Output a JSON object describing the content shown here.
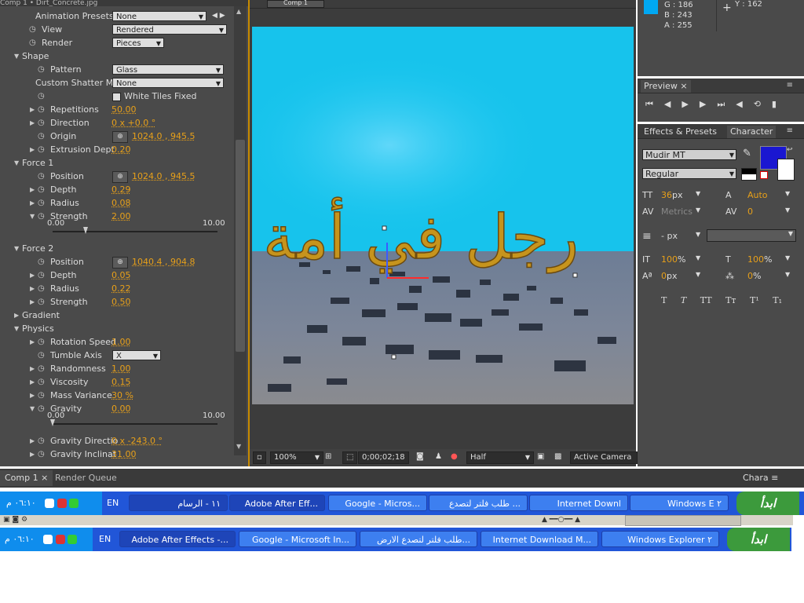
{
  "effects_panel": {
    "header": "Comp 1 • Dirt_Concrete.jpg",
    "rows": [
      {
        "type": "dd",
        "indent": 45,
        "label": "Animation Presets:",
        "value": "None",
        "width": 120
      },
      {
        "type": "dd",
        "indent": 45,
        "sw": true,
        "label": "View",
        "value": "Rendered",
        "width": 146
      },
      {
        "type": "dd",
        "indent": 45,
        "sw": true,
        "label": "Render",
        "value": "Pieces",
        "width": 66
      },
      {
        "type": "group",
        "indent": 16,
        "open": true,
        "label": "Shape"
      },
      {
        "type": "dd",
        "indent": 56,
        "sw": true,
        "label": "Pattern",
        "value": "Glass",
        "width": 142
      },
      {
        "type": "dd",
        "indent": 45,
        "label": "Custom Shatter Ma",
        "value": "None",
        "width": 142
      },
      {
        "type": "check",
        "indent": 56,
        "sw": true,
        "label": "",
        "value": "White Tiles Fixed"
      },
      {
        "type": "val",
        "indent": 56,
        "tri": true,
        "sw": true,
        "label": "Repetitions",
        "value": "50.00"
      },
      {
        "type": "val",
        "indent": 56,
        "tri": true,
        "sw": true,
        "label": "Direction",
        "value": "0 x +0.0 °"
      },
      {
        "type": "pt",
        "indent": 56,
        "sw": true,
        "label": "Origin",
        "value": "1024.0 , 945.5"
      },
      {
        "type": "val",
        "indent": 56,
        "tri": true,
        "sw": true,
        "label": "Extrusion Dept",
        "value": "0.20"
      },
      {
        "type": "group",
        "indent": 16,
        "open": true,
        "label": "Force 1"
      },
      {
        "type": "pt",
        "indent": 56,
        "sw": true,
        "label": "Position",
        "value": "1024.0 , 945.5"
      },
      {
        "type": "val",
        "indent": 56,
        "tri": true,
        "sw": true,
        "label": "Depth",
        "value": "0.29"
      },
      {
        "type": "val",
        "indent": 56,
        "tri": true,
        "sw": true,
        "label": "Radius",
        "value": "0.08"
      },
      {
        "type": "val",
        "indent": 56,
        "tri": true,
        "open": true,
        "sw": true,
        "label": "Strength",
        "value": "2.00"
      },
      {
        "type": "slider",
        "min": "0.00",
        "max": "10.00",
        "pos": 0.2
      },
      {
        "type": "group",
        "indent": 16,
        "open": true,
        "label": "Force 2"
      },
      {
        "type": "pt",
        "indent": 56,
        "sw": true,
        "label": "Position",
        "value": "1040.4 , 904.8"
      },
      {
        "type": "val",
        "indent": 56,
        "tri": true,
        "sw": true,
        "label": "Depth",
        "value": "0.05"
      },
      {
        "type": "val",
        "indent": 56,
        "tri": true,
        "sw": true,
        "label": "Radius",
        "value": "0.22"
      },
      {
        "type": "val",
        "indent": 56,
        "tri": true,
        "sw": true,
        "label": "Strength",
        "value": "0.50"
      },
      {
        "type": "group",
        "indent": 16,
        "open": false,
        "label": "Gradient"
      },
      {
        "type": "group",
        "indent": 16,
        "open": true,
        "label": "Physics"
      },
      {
        "type": "val",
        "indent": 56,
        "tri": true,
        "sw": true,
        "label": "Rotation Speed",
        "value": "1.00"
      },
      {
        "type": "dd",
        "indent": 56,
        "sw": true,
        "label": "Tumble Axis",
        "value": "X",
        "width": 62
      },
      {
        "type": "val",
        "indent": 56,
        "tri": true,
        "sw": true,
        "label": "Randomness",
        "value": "1.00"
      },
      {
        "type": "val",
        "indent": 56,
        "tri": true,
        "sw": true,
        "label": "Viscosity",
        "value": "0.15"
      },
      {
        "type": "val",
        "indent": 56,
        "tri": true,
        "sw": true,
        "label": "Mass Variance",
        "value": "30 %"
      },
      {
        "type": "val",
        "indent": 56,
        "tri": true,
        "open": true,
        "sw": true,
        "label": "Gravity",
        "value": "0.00"
      },
      {
        "type": "slider",
        "min": "0.00",
        "max": "10.00",
        "pos": 0.0
      },
      {
        "type": "val",
        "indent": 56,
        "tri": true,
        "sw": true,
        "label": "Gravity Directio",
        "value": "0 x -243.0 °"
      },
      {
        "type": "val",
        "indent": 56,
        "tri": true,
        "sw": true,
        "label": "Gravity Inclinat",
        "value": "31.00"
      }
    ]
  },
  "viewer": {
    "tab": "Comp 1",
    "arabic_text": "رجل في أمة",
    "zoom": "100%",
    "timecode": "0;00;02;18",
    "resolution": "Half",
    "camera": "Active Camera"
  },
  "info": {
    "g": "G : 186",
    "b": "B : 243",
    "a": "A : 255",
    "y": "Y : 162",
    "swatch": "#00a8f3"
  },
  "preview": {
    "tab": "Preview"
  },
  "character": {
    "tabs": [
      "Effects & Presets",
      "Character"
    ],
    "font": "Mudir MT",
    "style": "Regular",
    "size": "36",
    "size_unit": "px",
    "leading": "Auto",
    "kerning": "Metrics",
    "tracking": "0",
    "stroke_unit": "- px",
    "vscale": "100",
    "hscale": "100",
    "baseline": "0",
    "tsume": "0",
    "pct": "%",
    "px": "px",
    "fill_color": "#1a17d1",
    "type_buttons": [
      "T",
      "T",
      "TT",
      "Tт",
      "T¹",
      "T₁"
    ]
  },
  "bottom_tabs": [
    "Comp 1",
    "Render Queue",
    "Chara"
  ],
  "taskbar1": {
    "start": "ابدأ",
    "tasks": [
      "Windows E ٢",
      "Internet Downl",
      "طلب فلتر لتصدع ...",
      "Google - Micros...",
      "Adobe After Eff...",
      "١١ - الرسام"
    ],
    "lang": "EN",
    "time": "٠٦:١٠ م"
  },
  "taskbar2": {
    "start": "ابدأ",
    "tasks": [
      "Windows Explorer ٢",
      "Internet Download M...",
      "طلب فلتر لتصدع الارض...",
      "Google - Microsoft In...",
      "Adobe After Effects -..."
    ],
    "lang": "EN",
    "time": "٠٦:١٠ م"
  }
}
